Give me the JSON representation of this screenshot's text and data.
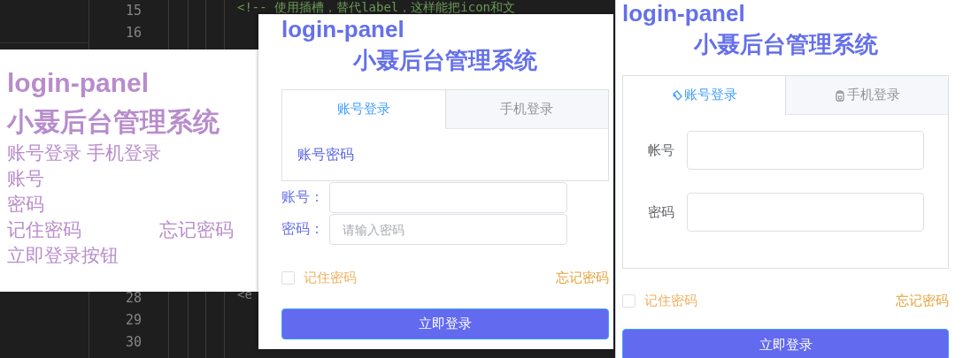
{
  "editor": {
    "lines": [
      {
        "number": "15",
        "code": "<!-- 使用插槽，替代label，这样能把icon和文",
        "kind": "comment"
      },
      {
        "number": "16"
      },
      {
        "number": "28",
        "code": "<e",
        "kind": "tag"
      },
      {
        "number": "29"
      },
      {
        "number": "30"
      }
    ]
  },
  "panels": [
    {
      "kind": "plain",
      "title": "login-panel",
      "subtitle": "小聂后台管理系统",
      "tabs": [
        {
          "label": "账号登录"
        },
        {
          "label": "手机登录"
        }
      ],
      "fields": [
        {
          "label": "账号"
        },
        {
          "label": "密码"
        }
      ],
      "remember": {
        "label": "记住密码"
      },
      "forgot": "忘记密码",
      "button": "立即登录按钮"
    },
    {
      "kind": "tabs_then_form",
      "title": "login-panel",
      "subtitle": "小聂后台管理系统",
      "tabs": [
        {
          "label": "账号登录",
          "selected": true
        },
        {
          "label": "手机登录",
          "selected": false
        }
      ],
      "tab_content": "账号密码",
      "fields": [
        {
          "label": "账号："
        },
        {
          "label": "密码：",
          "placeholder": "请输入密码"
        }
      ],
      "remember": {
        "label": "记住密码",
        "checked": false
      },
      "forgot": "忘记密码",
      "button": "立即登录"
    },
    {
      "kind": "form_in_tabs",
      "title": "login-panel",
      "subtitle": "小聂后台管理系统",
      "tabs": [
        {
          "label": "账号登录",
          "selected": true
        },
        {
          "label": "手机登录",
          "selected": false
        }
      ],
      "fields": [
        {
          "label": "帐号"
        },
        {
          "label": "密码"
        }
      ],
      "remember": {
        "label": "记住密码",
        "checked": false
      },
      "forgot": "忘记密码",
      "button": "立即登录"
    }
  ]
}
